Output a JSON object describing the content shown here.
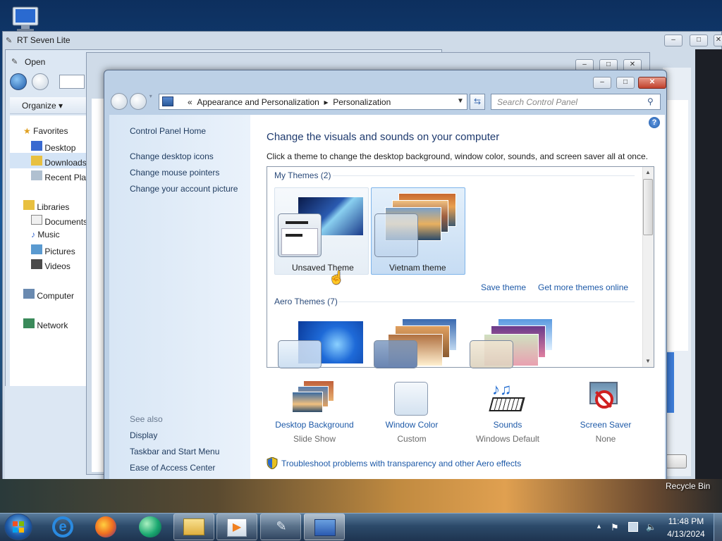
{
  "desktop": {
    "recycle_bin_label": "Recycle Bin"
  },
  "rt_window": {
    "title": "RT Seven Lite"
  },
  "open_dialog": {
    "title": "Open",
    "organize_label": "Organize",
    "sidebar": {
      "favorites_label": "Favorites",
      "favorites": [
        "Desktop",
        "Downloads",
        "Recent Places"
      ],
      "libraries_label": "Libraries",
      "libraries": [
        "Documents",
        "Music",
        "Pictures",
        "Videos"
      ],
      "computer_label": "Computer",
      "network_label": "Network"
    }
  },
  "control_panel": {
    "breadcrumb": {
      "root_chevron": "«",
      "parts": [
        "Appearance and Personalization",
        "Personalization"
      ]
    },
    "search_placeholder": "Search Control Panel",
    "left_nav": {
      "home": "Control Panel Home",
      "links": [
        "Change desktop icons",
        "Change mouse pointers",
        "Change your account picture"
      ],
      "see_also_label": "See also",
      "see_also": [
        "Display",
        "Taskbar and Start Menu",
        "Ease of Access Center"
      ]
    },
    "heading": "Change the visuals and sounds on your computer",
    "subheading": "Click a theme to change the desktop background, window color, sounds, and screen saver all at once.",
    "my_themes": {
      "label": "My Themes (2)",
      "items": [
        {
          "name": "Unsaved Theme",
          "state": "hover"
        },
        {
          "name": "Vietnam theme",
          "state": "selected"
        }
      ],
      "save_link": "Save theme",
      "more_link": "Get more themes online"
    },
    "aero_themes": {
      "label": "Aero Themes (7)"
    },
    "bottom_items": [
      {
        "title": "Desktop Background",
        "value": "Slide Show"
      },
      {
        "title": "Window Color",
        "value": "Custom"
      },
      {
        "title": "Sounds",
        "value": "Windows Default"
      },
      {
        "title": "Screen Saver",
        "value": "None"
      }
    ],
    "troubleshoot_link": "Troubleshoot problems with transparency and other Aero effects"
  },
  "taskbar": {
    "time": "11:48 PM",
    "date": "4/13/2024"
  },
  "colors": {
    "link": "#1e5aa8",
    "heading": "#1e3a6e",
    "selected_tile": "#c6dcf3",
    "close_button": "#c0402c"
  }
}
